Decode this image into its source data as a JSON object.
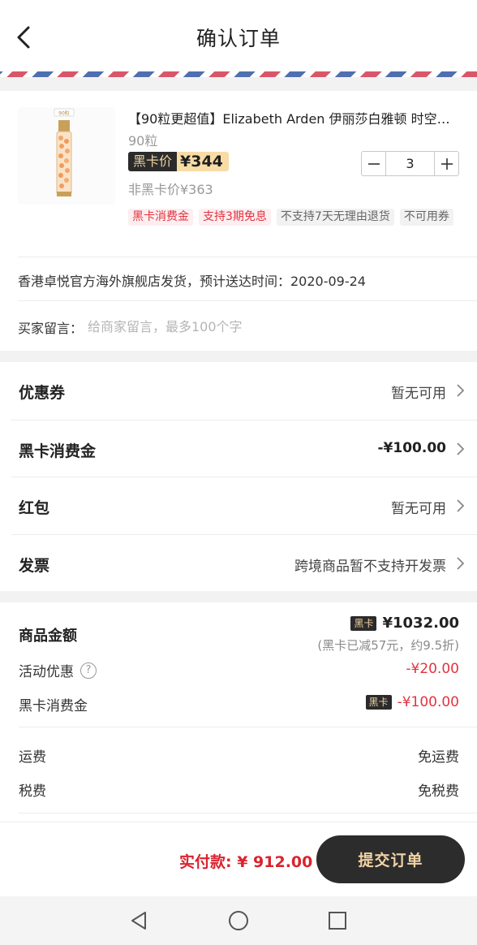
{
  "header": {
    "title": "确认订单"
  },
  "product": {
    "image_label": "90粒",
    "title": "【90粒更超值】Elizabeth Arden 伊丽莎白雅顿 时空…",
    "spec": "90粒",
    "price_tag": "黑卡价",
    "price": "¥344",
    "non_member_price": "非黑卡价¥363",
    "quantity": "3",
    "tags": [
      {
        "text": "黑卡消费金",
        "style": "red"
      },
      {
        "text": "支持3期免息",
        "style": "red"
      },
      {
        "text": "不支持7天无理由退货",
        "style": "gray"
      },
      {
        "text": "不可用券",
        "style": "gray"
      }
    ],
    "shipping_info": "香港卓悦官方海外旗舰店发货，预计送达时间：2020-09-24",
    "message_label": "买家留言：",
    "message_placeholder": "给商家留言，最多100个字"
  },
  "options": [
    {
      "label": "优惠券",
      "value": "暂无可用"
    },
    {
      "label": "黑卡消费金",
      "value": "-¥100.00"
    },
    {
      "label": "红包",
      "value": "暂无可用"
    },
    {
      "label": "发票",
      "value": "跨境商品暂不支持开发票"
    }
  ],
  "summary": {
    "goods_label": "商品金额",
    "goods_badge": "黑卡",
    "goods_amount": "¥1032.00",
    "goods_sub": "(黑卡已减57元，约9.5折)",
    "activity_label": "活动优惠",
    "activity_amount": "-¥20.00",
    "blackcard_label": "黑卡消费金",
    "blackcard_badge": "黑卡",
    "blackcard_amount": "-¥100.00",
    "shipping_label": "运费",
    "shipping_value": "免运费",
    "tax_label": "税费",
    "tax_value": "免税费"
  },
  "bottom": {
    "pay_label": "实付款: ¥ 912.00",
    "submit_label": "提交订单"
  },
  "colors": {
    "accent_red": "#e23340",
    "dark_button": "#2c2c2c",
    "gold_text": "#f2d3a5"
  }
}
